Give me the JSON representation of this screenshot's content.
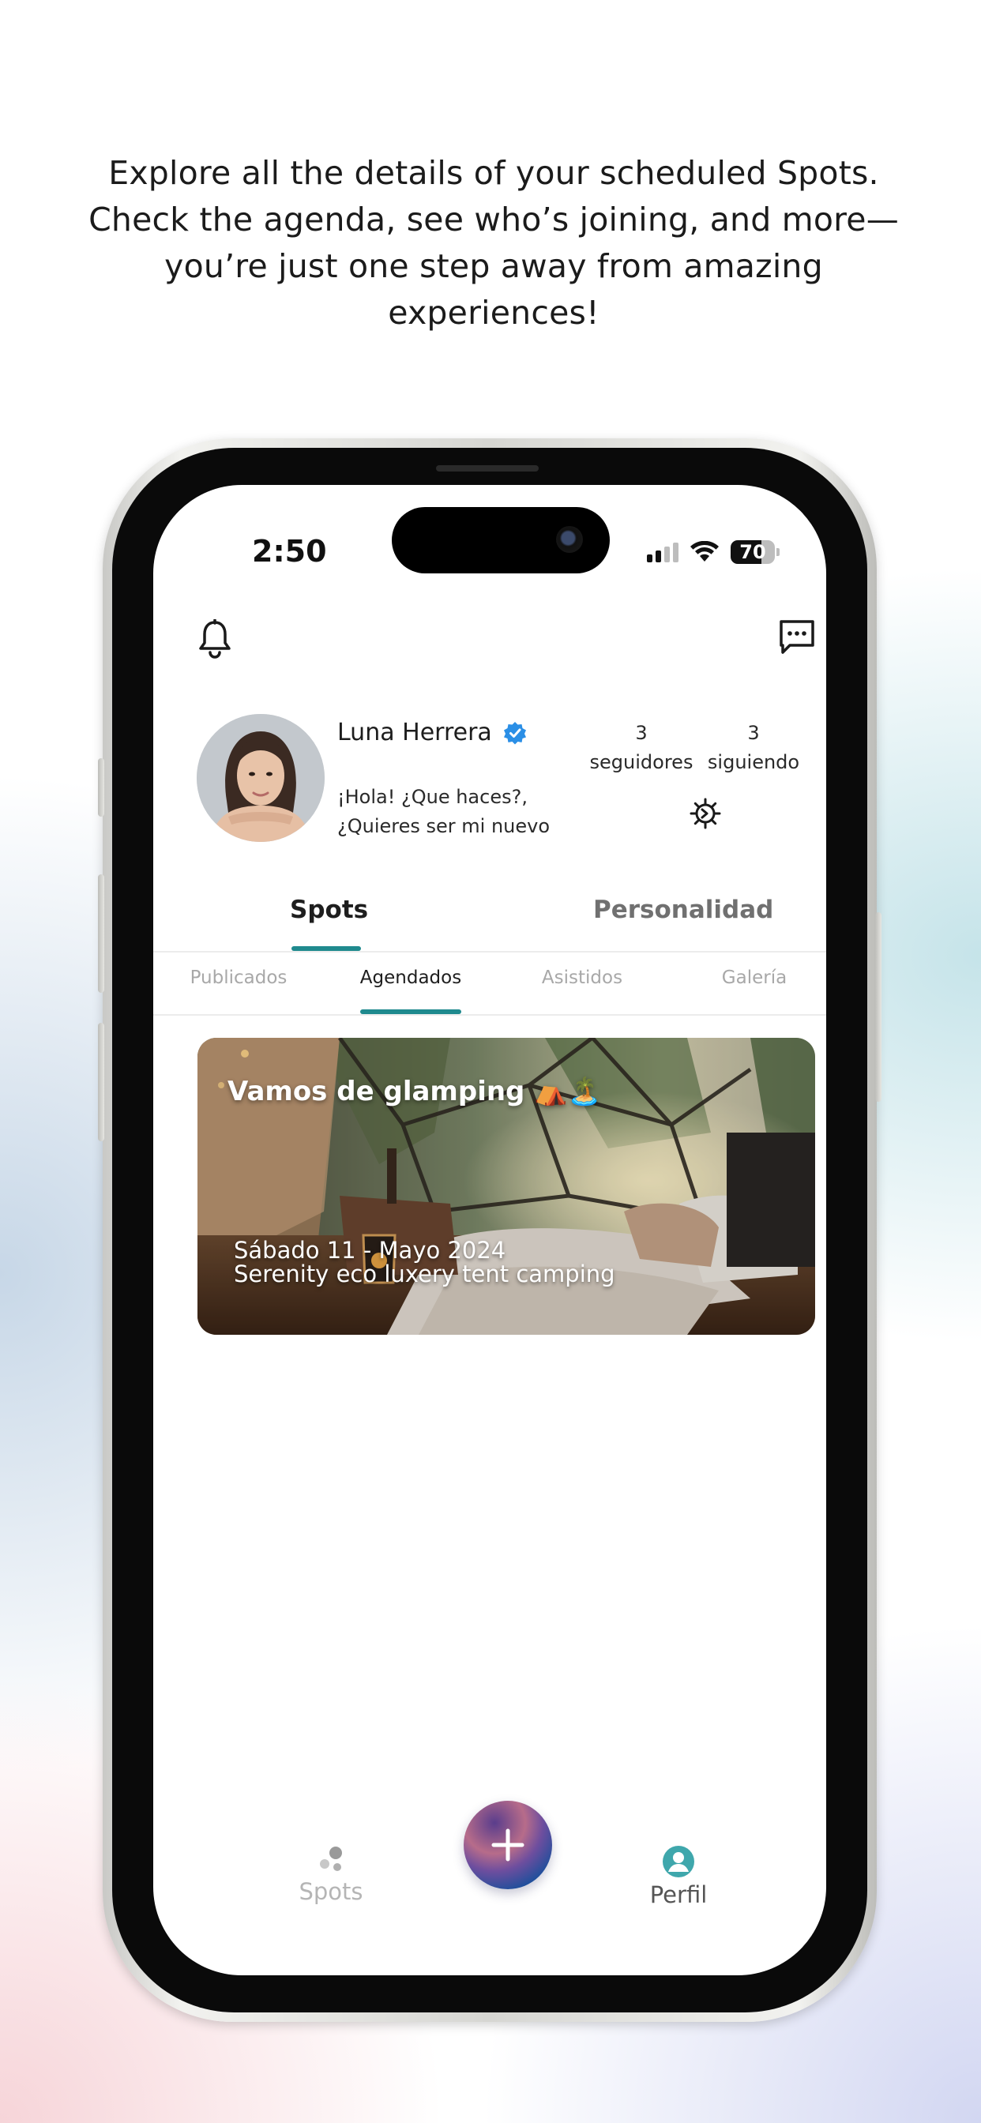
{
  "caption": "Explore all the details of your scheduled Spots. Check the agenda, see who’s joining, and more—you’re just one step away from amazing experiences!",
  "status_bar": {
    "time": "2:50",
    "battery": "70"
  },
  "header": {
    "left_icon": "bell-icon",
    "right_icon": "chat-icon"
  },
  "profile": {
    "name": "Luna Herrera",
    "verified_icon": "verified-badge-icon",
    "bio_line1": "¡Hola! ¿Que haces?,",
    "bio_line2": "¿Quieres ser mi nuevo",
    "followers_count": "3",
    "followers_label": "seguidores",
    "following_count": "3",
    "following_label": "siguiendo",
    "settings_icon": "gear-icon"
  },
  "main_tabs": [
    {
      "label": "Spots",
      "active": true
    },
    {
      "label": "Personalidad",
      "active": false
    }
  ],
  "sub_tabs": [
    {
      "label": "Publicados",
      "active": false
    },
    {
      "label": "Agendados",
      "active": true
    },
    {
      "label": "Asistidos",
      "active": false
    },
    {
      "label": "Galería",
      "active": false
    }
  ],
  "spot_card": {
    "title": "Vamos de glamping ⛺🏝️",
    "date": "Sábado 11 - Mayo 2024",
    "place": "Serenity eco luxery tent camping"
  },
  "bottom_nav": {
    "spots_label": "Spots",
    "add_icon": "plus-icon",
    "profile_label": "Perfil"
  },
  "colors": {
    "accent": "#1f8a8e",
    "inactive_text": "#a8a8a8",
    "profile_nav": "#3fa7ac"
  }
}
